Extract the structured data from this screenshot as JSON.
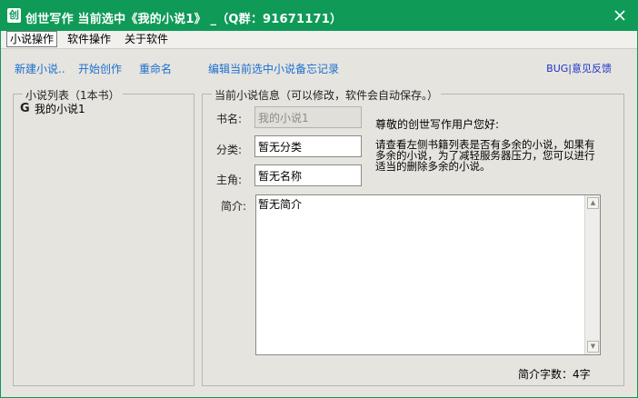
{
  "window": {
    "title": "创世写作 当前选中《我的小说1》 _（Q群：91671171）",
    "app_icon_glyph": "创",
    "close_glyph": "✕",
    "accent_color": "#0f9a58"
  },
  "menu": {
    "items": [
      "小说操作",
      "软件操作",
      "关于软件"
    ]
  },
  "toolbar": {
    "new_novel": "新建小说..",
    "start_writing": "开始创作",
    "rename": "重命名",
    "edit_memo": "编辑当前选中小说备忘记录",
    "feedback": "BUG|意见反馈"
  },
  "novel_list": {
    "title": "小说列表（1本书）",
    "items": [
      {
        "label": "我的小说1",
        "icon": "novel-icon"
      }
    ]
  },
  "info": {
    "title": "当前小说信息（可以修改，软件会自动保存。）",
    "book_name_label": "书名:",
    "book_name_value": "我的小说1",
    "category_label": "分类:",
    "category_value": "暂无分类",
    "protagonist_label": "主角:",
    "protagonist_value": "暂无名称",
    "intro_label": "简介:",
    "intro_value": "暂无简介",
    "greeting": "尊敬的创世写作用户您好:",
    "notice": "请查看左侧书籍列表是否有多余的小说，如果有多余的小说，为了减轻服务器压力，您可以进行适当的删除多余的小说。",
    "char_count": "简介字数：4字"
  }
}
